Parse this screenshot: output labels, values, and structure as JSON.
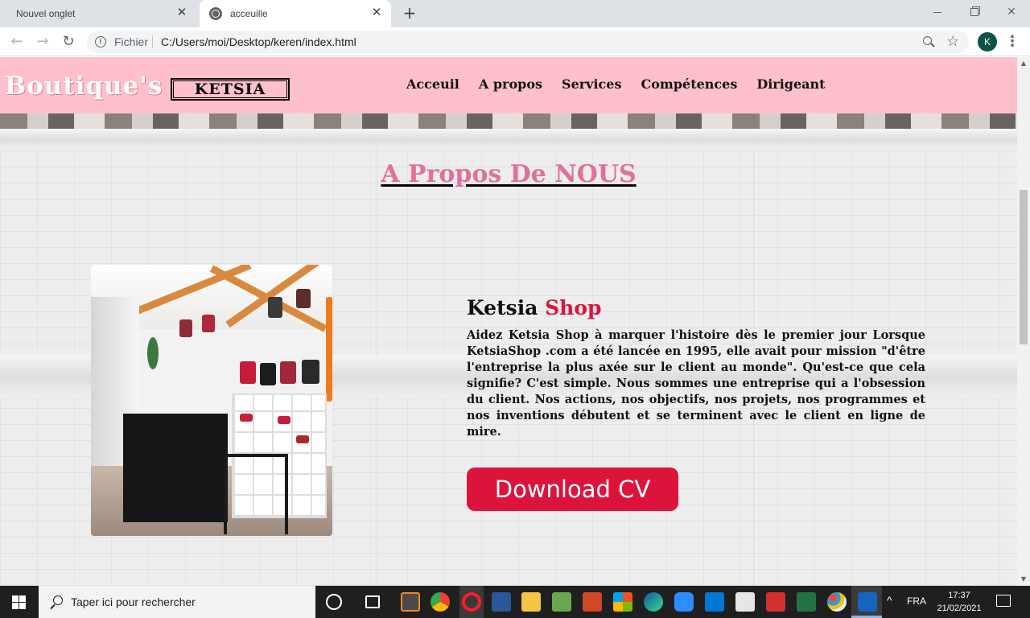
{
  "browser": {
    "tabs": [
      {
        "title": "Nouvel onglet",
        "active": false
      },
      {
        "title": "acceuille",
        "active": true
      }
    ],
    "new_tab_glyph": "+",
    "close_glyph": "✕",
    "address": {
      "scheme_label": "Fichier",
      "url": "C:/Users/moi/Desktop/keren/index.html"
    },
    "profile_initial": "K",
    "icons": [
      "back-arrow-icon",
      "forward-arrow-icon",
      "reload-icon",
      "info-icon",
      "zoom-icon",
      "star-icon",
      "menu-icon"
    ]
  },
  "site": {
    "brand": "Boutique's",
    "brand_box": "KETSIA",
    "nav": [
      "Acceuil",
      "A propos",
      "Services",
      "Compétences",
      "Dirigeant"
    ],
    "colors": {
      "nav_bg": "#ffc0cb",
      "accent": "#dc143c",
      "title_pink": "#e0709e"
    },
    "about": {
      "title": "A Propos De NOUS",
      "heading_main": "Ketsia",
      "heading_accent": "Shop",
      "body": "Aidez Ketsia Shop à marquer l'histoire dès le premier jour Lorsque KetsiaShop .com a été lancée en 1995, elle avait pour mission \"d'être l'entreprise la plus axée sur le client au monde\". Qu'est-ce que cela signifie? C'est simple. Nous sommes une entreprise qui a l'obsession du client. Nos actions, nos objectifs, nos projets, nos programmes et nos inventions débutent et se terminent avec le client en ligne de mire.",
      "button": "Download CV"
    }
  },
  "taskbar": {
    "search_placeholder": "Taper ici pour rechercher",
    "apps": [
      "sublime-text-icon",
      "chrome-icon",
      "opera-icon",
      "word-icon",
      "file-explorer-icon",
      "notepad-icon",
      "powerpoint-icon",
      "store-tiles-icon",
      "edge-icon",
      "zoom-app-icon",
      "mail-icon",
      "microsoft-store-icon",
      "pdf-icon",
      "excel-icon",
      "paint-icon",
      "active-app-icon"
    ],
    "tray": {
      "chevron": "^",
      "language": "FRA",
      "time": "17:37",
      "date": "21/02/2021"
    }
  }
}
